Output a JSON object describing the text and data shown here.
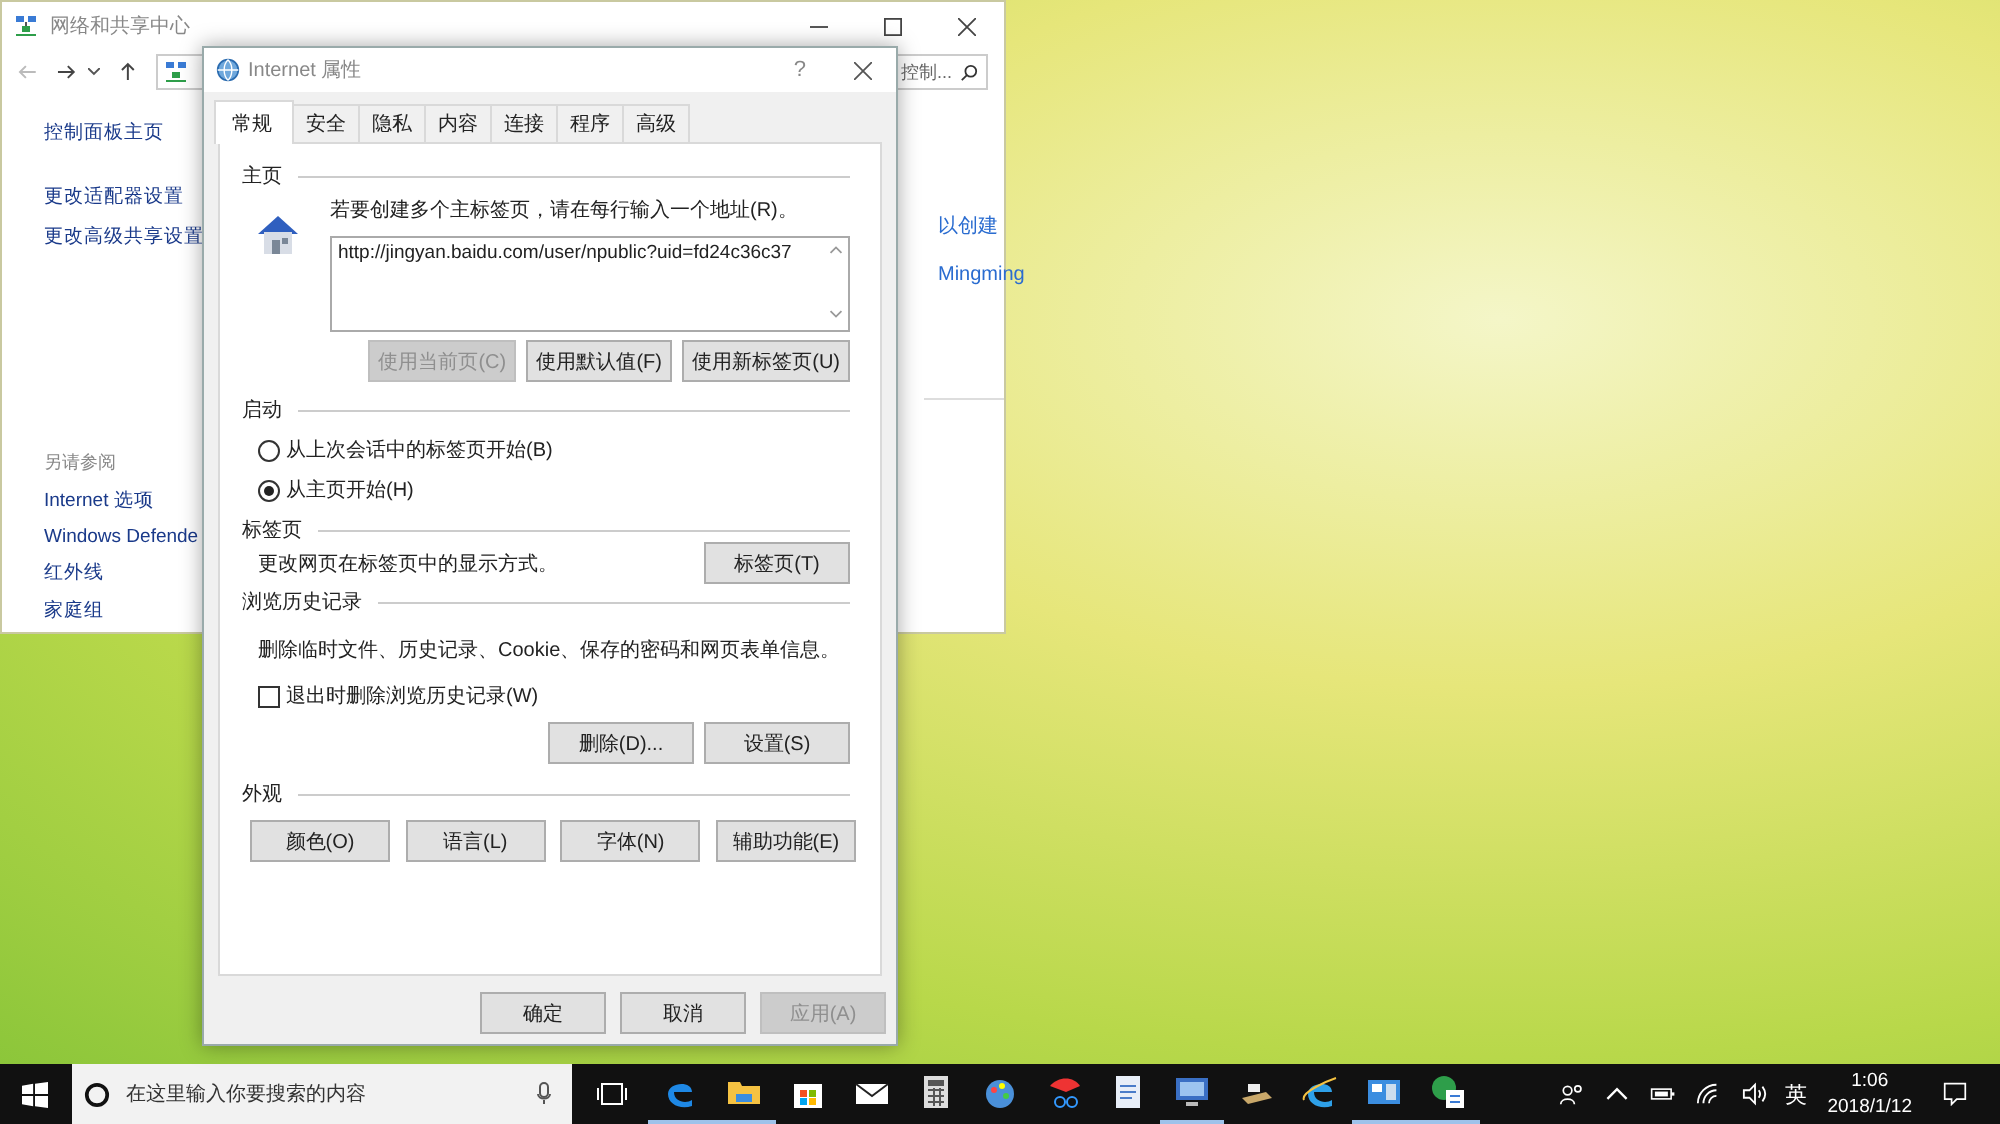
{
  "background_window": {
    "title": "网络和共享中心",
    "search_placeholder": "控制...",
    "sidebar": {
      "links": [
        {
          "label": "控制面板主页"
        },
        {
          "label": "更改适配器设置"
        },
        {
          "label": "更改高级共享设置"
        }
      ],
      "see_also_heading": "另请参阅",
      "see_also": [
        {
          "label": "Internet 选项"
        },
        {
          "label": "Windows Defende"
        },
        {
          "label": "红外线"
        },
        {
          "label": "家庭组"
        }
      ]
    },
    "content_fragments": [
      "以创建",
      "Mingming"
    ]
  },
  "dialog": {
    "title": "Internet 属性",
    "help_label": "?",
    "tabs": [
      {
        "label": "常规",
        "selected": true
      },
      {
        "label": "安全",
        "selected": false
      },
      {
        "label": "隐私",
        "selected": false
      },
      {
        "label": "内容",
        "selected": false
      },
      {
        "label": "连接",
        "selected": false
      },
      {
        "label": "程序",
        "selected": false
      },
      {
        "label": "高级",
        "selected": false
      }
    ],
    "home_page": {
      "heading": "主页",
      "instruction": "若要创建多个主标签页，请在每行输入一个地址(R)。",
      "url": "http://jingyan.baidu.com/user/npublic?uid=fd24c36c37",
      "buttons": [
        {
          "label": "使用当前页(C)",
          "disabled": true
        },
        {
          "label": "使用默认值(F)",
          "disabled": false
        },
        {
          "label": "使用新标签页(U)",
          "disabled": false
        }
      ]
    },
    "startup": {
      "heading": "启动",
      "options": [
        {
          "label": "从上次会话中的标签页开始(B)",
          "selected": false
        },
        {
          "label": "从主页开始(H)",
          "selected": true
        }
      ]
    },
    "tabs_section": {
      "heading": "标签页",
      "description": "更改网页在标签页中的显示方式。",
      "button": "标签页(T)"
    },
    "history": {
      "heading": "浏览历史记录",
      "description": "删除临时文件、历史记录、Cookie、保存的密码和网页表单信息。",
      "checkbox": {
        "label": "退出时删除浏览历史记录(W)",
        "checked": false
      },
      "buttons": [
        {
          "label": "删除(D)...",
          "disabled": false
        },
        {
          "label": "设置(S)",
          "disabled": false
        }
      ]
    },
    "appearance": {
      "heading": "外观",
      "buttons": [
        {
          "label": "颜色(O)",
          "disabled": false
        },
        {
          "label": "语言(L)",
          "disabled": false
        },
        {
          "label": "字体(N)",
          "disabled": false
        },
        {
          "label": "辅助功能(E)",
          "disabled": false
        }
      ]
    },
    "footer_buttons": [
      {
        "label": "确定",
        "disabled": false
      },
      {
        "label": "取消",
        "disabled": false
      },
      {
        "label": "应用(A)",
        "disabled": true
      }
    ]
  },
  "taskbar": {
    "search_placeholder": "在这里输入你要搜索的内容",
    "apps": [
      {
        "kind": "edge",
        "running": true
      },
      {
        "kind": "folder",
        "running": true
      },
      {
        "kind": "store",
        "running": false
      },
      {
        "kind": "mail",
        "running": false
      },
      {
        "kind": "calculator",
        "running": false
      },
      {
        "kind": "paint",
        "running": false
      },
      {
        "kind": "scissors",
        "running": false
      },
      {
        "kind": "document",
        "running": false
      },
      {
        "kind": "monitor",
        "running": true
      },
      {
        "kind": "scanner",
        "running": false
      },
      {
        "kind": "ie",
        "running": false
      },
      {
        "kind": "panel",
        "running": true
      },
      {
        "kind": "globe",
        "running": true
      }
    ],
    "ime": "英",
    "time": "1:06",
    "date": "2018/1/12"
  }
}
